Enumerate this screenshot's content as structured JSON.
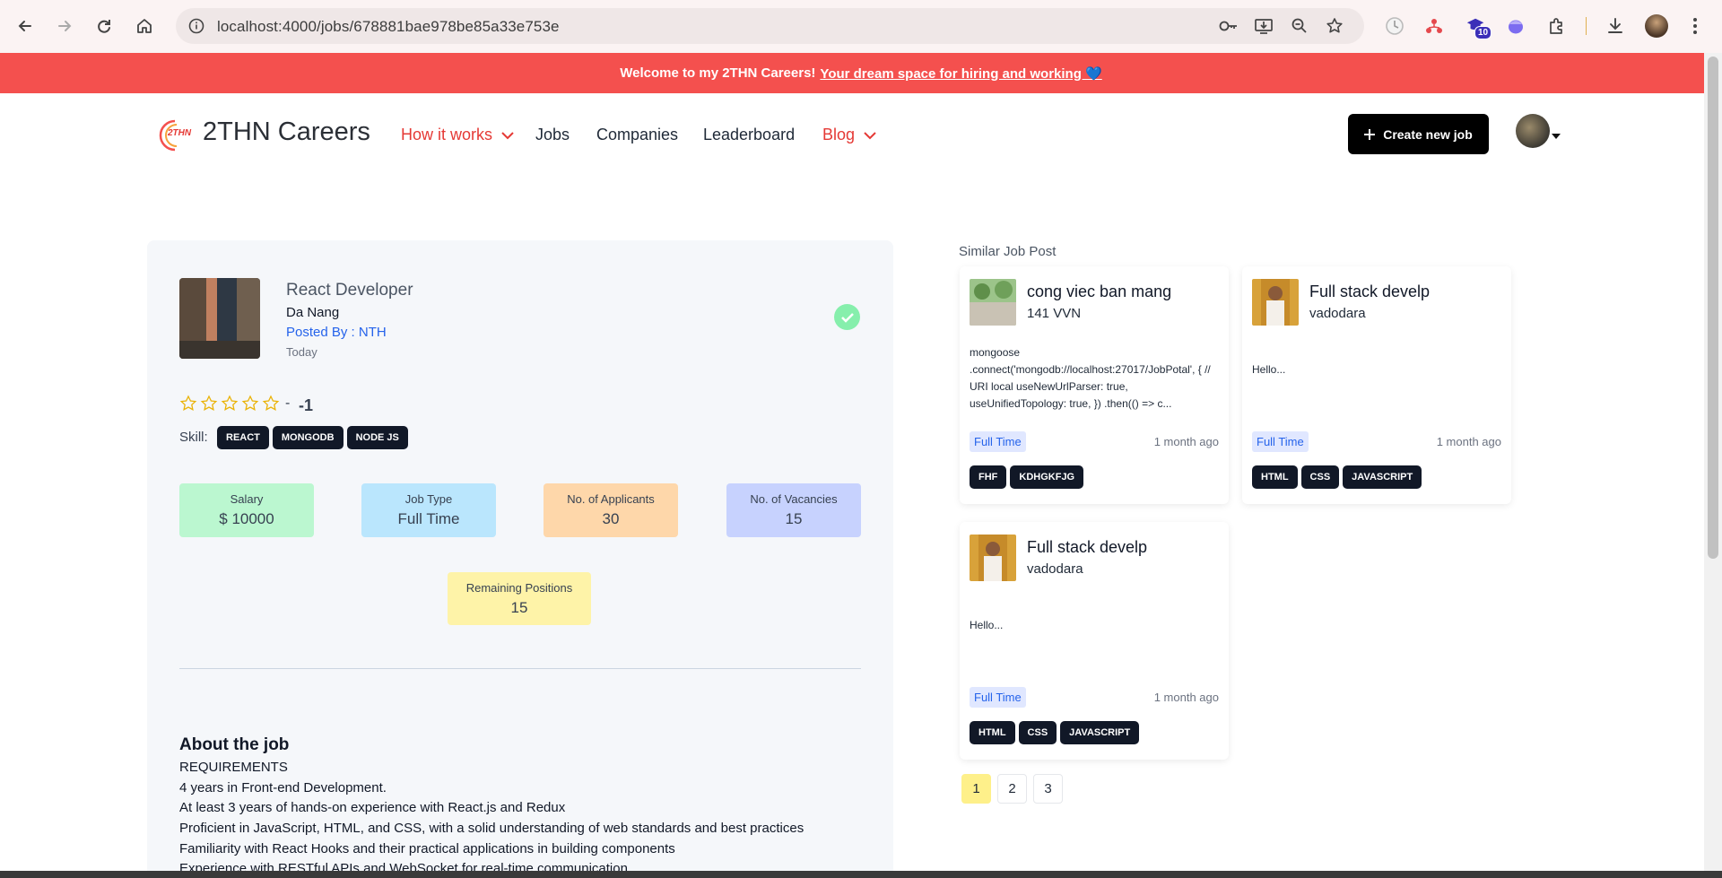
{
  "browser": {
    "url": "localhost:4000/jobs/678881bae978be85a33e753e",
    "extension_badge": "10"
  },
  "banner": {
    "bold_text": "Welcome to my 2THN Careers!",
    "link_text": "Your dream space for hiring and working 💙"
  },
  "header": {
    "logo_text": "2THN Careers",
    "logo_badge": "2THN",
    "nav": {
      "how_it_works": "How it works",
      "jobs": "Jobs",
      "companies": "Companies",
      "leaderboard": "Leaderboard",
      "blog": "Blog"
    },
    "create_button": "Create new job"
  },
  "job": {
    "title": "React Developer",
    "location": "Da Nang",
    "posted_by": "Posted By : NTH",
    "posted_time": "Today",
    "rating_dash": "-",
    "rating_value": "-1",
    "skill_label": "Skill:",
    "skills": [
      "REACT",
      "MONGODB",
      "NODE JS"
    ],
    "stats": {
      "salary_label": "Salary",
      "salary_value": "$ 10000",
      "job_type_label": "Job Type",
      "job_type_value": "Full Time",
      "applicants_label": "No. of Applicants",
      "applicants_value": "30",
      "vacancies_label": "No. of Vacancies",
      "vacancies_value": "15",
      "remaining_label": "Remaining Positions",
      "remaining_value": "15"
    },
    "about_heading": "About the job",
    "about_lines": [
      "REQUIREMENTS",
      "4 years in Front-end Development.",
      "At least 3 years of hands-on experience with React.js and Redux",
      "Proficient in JavaScript, HTML, and CSS, with a solid understanding of web standards and best practices",
      "Familiarity with React Hooks and their practical applications in building components",
      "Experience with RESTful APIs and WebSocket for real-time communication"
    ]
  },
  "similar": {
    "heading": "Similar Job Post",
    "cards": [
      {
        "title": "cong viec ban mang",
        "location": "141 VVN",
        "desc": "mongoose .connect('mongodb://localhost:27017/JobPotal', { // URI local useNewUrlParser: true, useUnifiedTopology: true, }) .then(() => c...",
        "type": "Full Time",
        "time": "1 month ago",
        "tags": [
          "FHF",
          "KDHGKFJG"
        ]
      },
      {
        "title": "Full stack develp",
        "location": "vadodara",
        "desc": "Hello...",
        "type": "Full Time",
        "time": "1 month ago",
        "tags": [
          "HTML",
          "CSS",
          "JAVASCRIPT"
        ]
      },
      {
        "title": "Full stack develp",
        "location": "vadodara",
        "desc": "Hello...",
        "type": "Full Time",
        "time": "1 month ago",
        "tags": [
          "HTML",
          "CSS",
          "JAVASCRIPT"
        ]
      }
    ],
    "pages": [
      "1",
      "2",
      "3"
    ],
    "current_page": "1"
  }
}
